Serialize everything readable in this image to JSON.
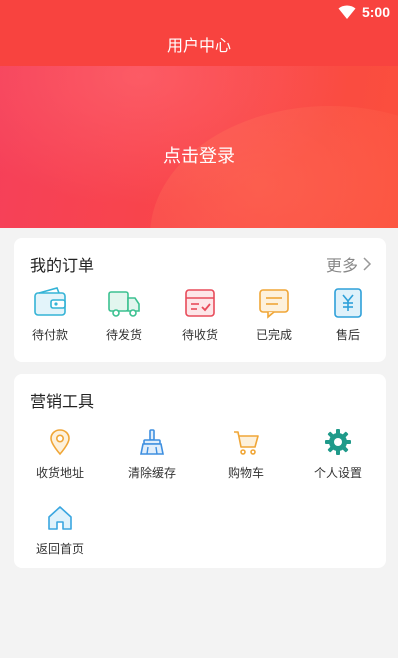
{
  "status_bar": {
    "time": "5:00",
    "wifi_icon": "wifi-icon"
  },
  "nav": {
    "title": "用户中心"
  },
  "hero": {
    "login_text": "点击登录"
  },
  "orders": {
    "title": "我的订单",
    "more_label": "更多",
    "items": [
      {
        "label": "待付款",
        "icon": "wallet-icon",
        "color": "#34b3d6"
      },
      {
        "label": "待发货",
        "icon": "truck-icon",
        "color": "#3cc191"
      },
      {
        "label": "待收货",
        "icon": "box-check-icon",
        "color": "#e84b5a"
      },
      {
        "label": "已完成",
        "icon": "message-icon",
        "color": "#f0a637"
      },
      {
        "label": "售后",
        "icon": "yuan-refund-icon",
        "color": "#2ea0d9"
      }
    ]
  },
  "tools": {
    "title": "营销工具",
    "items": [
      {
        "label": "收货地址",
        "icon": "location-pin-icon",
        "color": "#f0a637"
      },
      {
        "label": "清除缓存",
        "icon": "broom-icon",
        "color": "#3e8fe0"
      },
      {
        "label": "购物车",
        "icon": "cart-icon",
        "color": "#f0a637"
      },
      {
        "label": "个人设置",
        "icon": "gear-icon",
        "color": "#1f9a8a"
      },
      {
        "label": "返回首页",
        "icon": "home-icon",
        "color": "#3aa6e0"
      }
    ]
  },
  "theme": {
    "primary": "#f8433f",
    "background": "#f3f3f3"
  }
}
